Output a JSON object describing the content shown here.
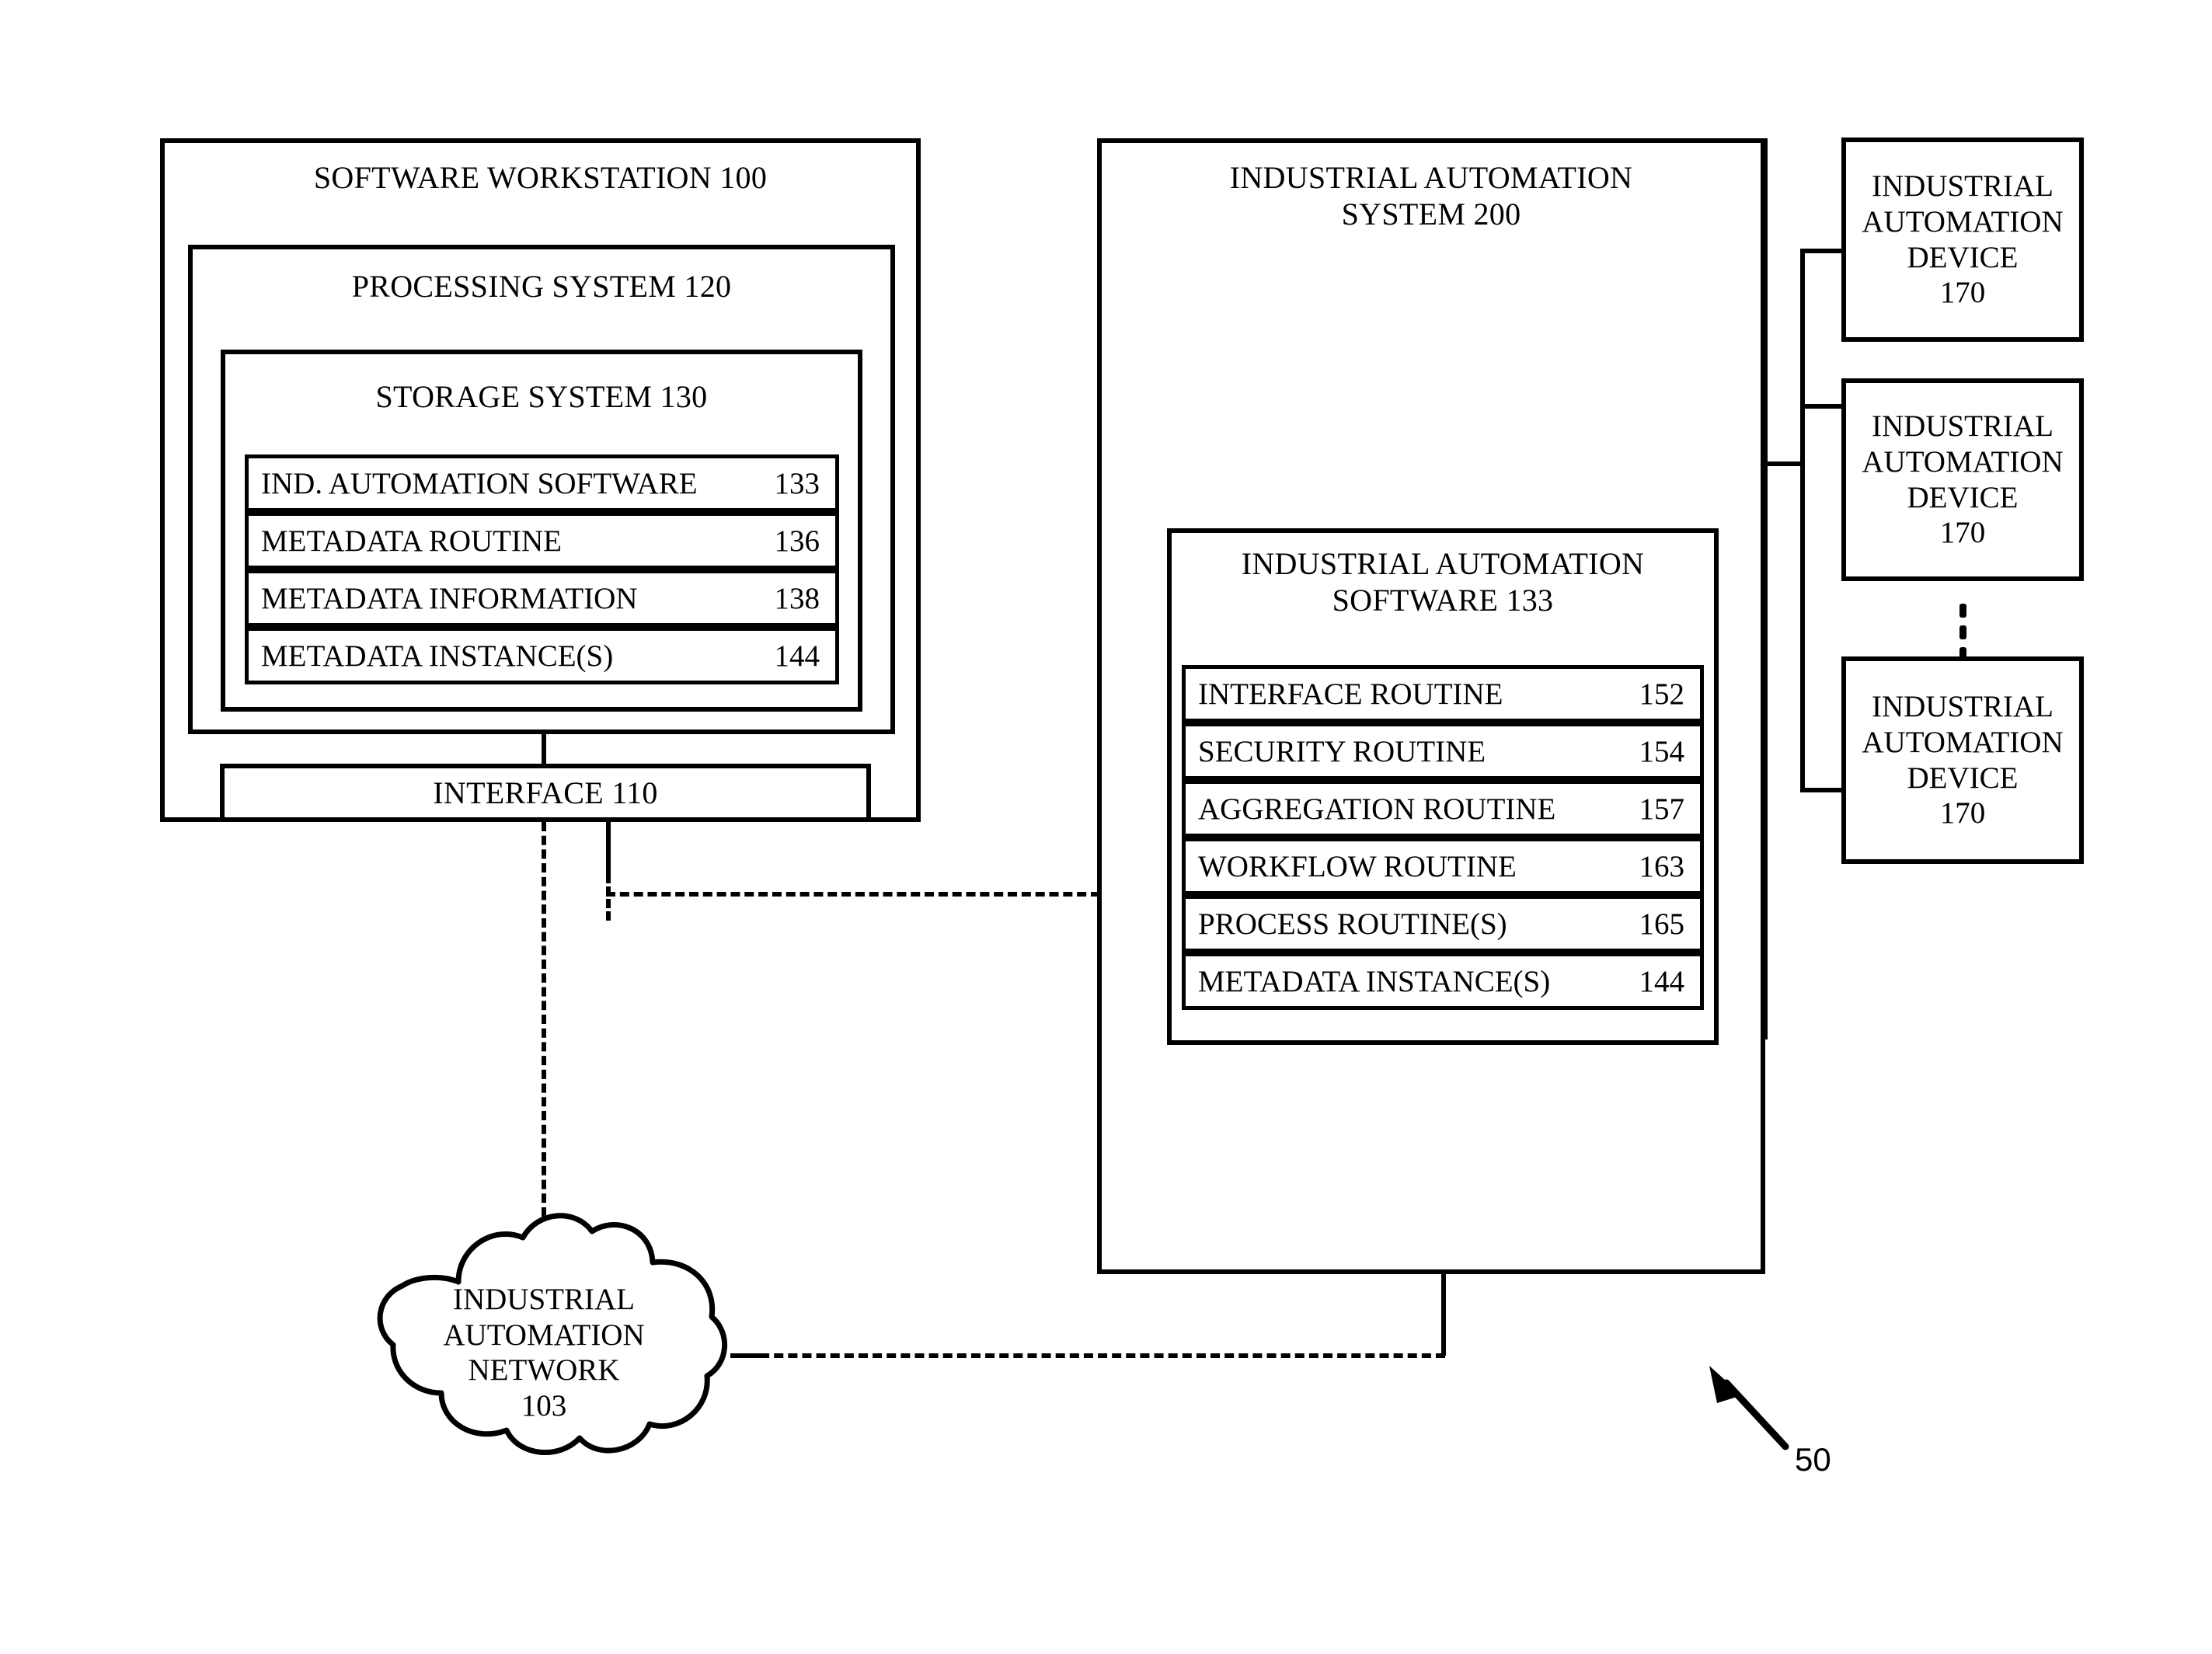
{
  "figure": {
    "reference_number": "50"
  },
  "workstation": {
    "title": "SOFTWARE WORKSTATION  100",
    "processing_system": {
      "title": "PROCESSING SYSTEM  120",
      "storage_system": {
        "title": "STORAGE SYSTEM  130",
        "rows": [
          {
            "label": "IND. AUTOMATION SOFTWARE",
            "num": "133"
          },
          {
            "label": "METADATA ROUTINE",
            "num": "136"
          },
          {
            "label": "METADATA INFORMATION",
            "num": "138"
          },
          {
            "label": "METADATA INSTANCE(S)",
            "num": "144"
          }
        ]
      }
    },
    "interface": {
      "title": "INTERFACE  110"
    }
  },
  "automation_system": {
    "title": "INDUSTRIAL AUTOMATION\nSYSTEM 200",
    "software": {
      "title": "INDUSTRIAL AUTOMATION\nSOFTWARE  133",
      "rows": [
        {
          "label": "INTERFACE ROUTINE",
          "num": "152"
        },
        {
          "label": "SECURITY ROUTINE",
          "num": "154"
        },
        {
          "label": "AGGREGATION ROUTINE",
          "num": "157"
        },
        {
          "label": "WORKFLOW ROUTINE",
          "num": "163"
        },
        {
          "label": "PROCESS ROUTINE(S)",
          "num": "165"
        },
        {
          "label": "METADATA INSTANCE(S)",
          "num": "144"
        }
      ]
    }
  },
  "devices": [
    {
      "title": "INDUSTRIAL\nAUTOMATION\nDEVICE\n170"
    },
    {
      "title": "INDUSTRIAL\nAUTOMATION\nDEVICE\n170"
    },
    {
      "title": "INDUSTRIAL\nAUTOMATION\nDEVICE\n170"
    }
  ],
  "network": {
    "title": "INDUSTRIAL\nAUTOMATION\nNETWORK\n103"
  }
}
